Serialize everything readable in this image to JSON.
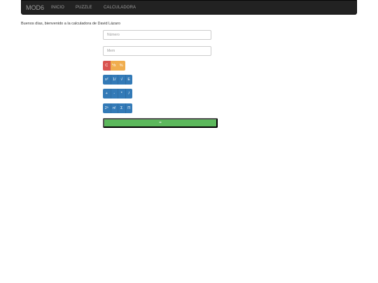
{
  "navbar": {
    "brand": "MOD6",
    "links": [
      "INICIO",
      "PUZZLE",
      "CALCULADORA"
    ]
  },
  "welcome_text": "Buenos días, bienvenido a la calculadora de David Lázaro",
  "inputs": {
    "number_placeholder": "Número",
    "memory_placeholder": "Mem"
  },
  "button_rows": [
    [
      "C",
      "⅟x",
      "%"
    ],
    [
      "x²",
      "1/",
      "√",
      "E"
    ],
    [
      "+",
      "-",
      "*",
      "/"
    ],
    [
      "2ⁿ",
      "n!",
      "Σ",
      "Π"
    ]
  ],
  "equals_label": "=",
  "colors": {
    "navbar": "#222222",
    "danger": "#d9534f",
    "warning": "#f0ad4e",
    "primary": "#337ab7",
    "success": "#5cb85c"
  }
}
